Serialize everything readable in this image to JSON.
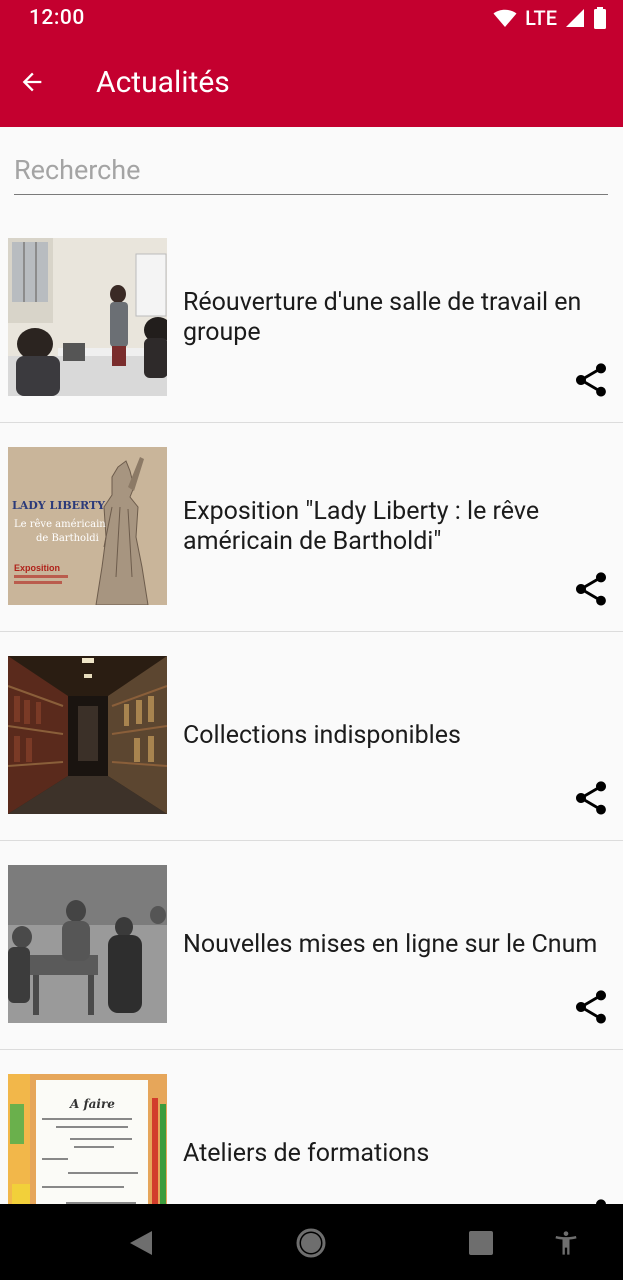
{
  "status": {
    "time": "12:00",
    "network": "LTE"
  },
  "app_bar": {
    "title": "Actualités",
    "back_icon": "arrow-back-icon"
  },
  "search": {
    "placeholder": "Recherche",
    "value": ""
  },
  "news": [
    {
      "title": "Réouverture d'une salle de travail en groupe",
      "thumbnail": "group-workroom-photo"
    },
    {
      "title": "Exposition \"Lady Liberty : le rêve américain de Bartholdi\"",
      "thumbnail": "lady-liberty-poster",
      "poster": {
        "heading": "LADY LIBERTY",
        "line1": "Le rêve américain",
        "line2": "de Bartholdi",
        "label": "Exposition"
      }
    },
    {
      "title": "Collections indisponibles",
      "thumbnail": "library-stacks-photo"
    },
    {
      "title": "Nouvelles mises en ligne sur le Cnum",
      "thumbnail": "historical-workshop-photo"
    },
    {
      "title": "Ateliers de formations",
      "thumbnail": "todo-list-photo",
      "note": {
        "heading": "A faire"
      }
    }
  ],
  "colors": {
    "primary": "#c4002f",
    "background": "#fafafa",
    "divider": "#dcdcdc"
  },
  "icons": {
    "share": "share-icon",
    "nav_back": "nav-back-icon",
    "nav_home": "nav-home-icon",
    "nav_recents": "nav-recents-icon",
    "accessibility": "accessibility-icon"
  }
}
